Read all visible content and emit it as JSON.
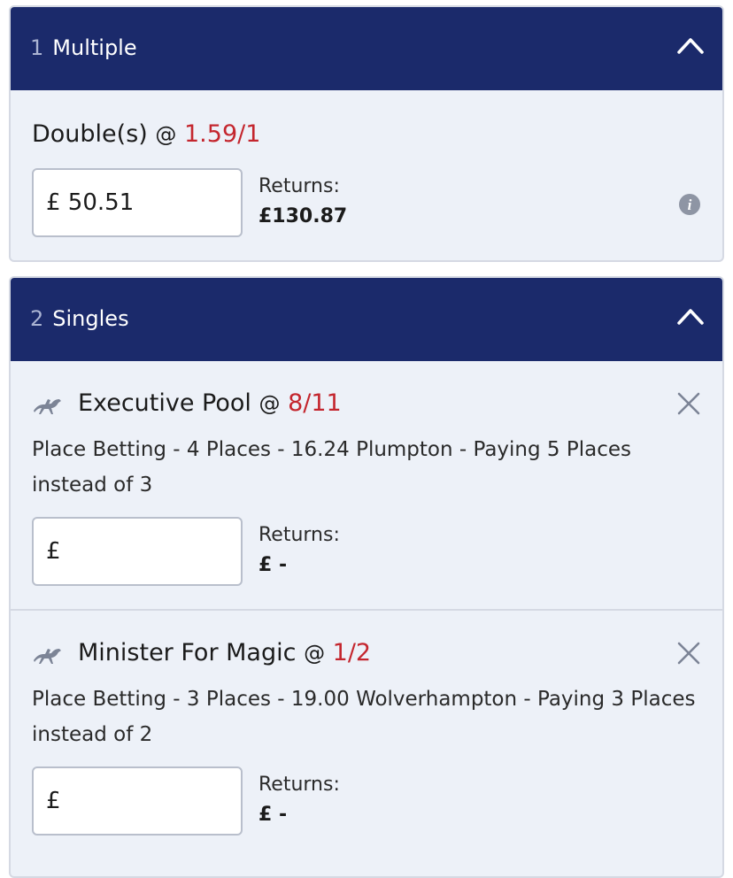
{
  "multiple": {
    "count": "1",
    "title": "Multiple",
    "bet_name": "Double(s)",
    "at": "@",
    "odds": "1.59/1",
    "stake": "£ 50.51",
    "returns_label": "Returns:",
    "returns_value": "£130.87"
  },
  "singles": {
    "count": "2",
    "title": "Singles",
    "bets": [
      {
        "name": "Executive Pool",
        "at": "@",
        "odds": "8/11",
        "description": "Place Betting - 4 Places - 16.24 Plumpton - Paying 5 Places instead of 3",
        "stake": "£",
        "returns_label": "Returns:",
        "returns_value": "£ -"
      },
      {
        "name": "Minister For Magic",
        "at": "@",
        "odds": "1/2",
        "description": "Place Betting - 3 Places - 19.00 Wolverhampton - Paying 3 Places instead of 2",
        "stake": "£",
        "returns_label": "Returns:",
        "returns_value": "£ -"
      }
    ]
  },
  "colors": {
    "header_bg": "#1b2a6b",
    "odds": "#c4262e",
    "panel_bg": "#edf1f8"
  },
  "icons": {
    "collapse": "chevron-up-icon",
    "info": "info-icon",
    "sport": "horse-racing-icon",
    "remove": "close-icon"
  }
}
